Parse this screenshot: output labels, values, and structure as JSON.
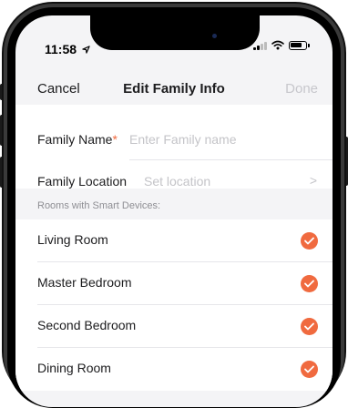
{
  "status_bar": {
    "time": "11:58",
    "location_icon": "location-arrow-icon"
  },
  "navbar": {
    "cancel_label": "Cancel",
    "title": "Edit Family Info",
    "done_label": "Done"
  },
  "form": {
    "family_name": {
      "label": "Family Name",
      "required_marker": "*",
      "placeholder": "Enter Family name",
      "value": ""
    },
    "family_location": {
      "label": "Family Location",
      "placeholder": "Set location",
      "chevron_glyph": ">"
    }
  },
  "rooms_section": {
    "title": "Rooms with Smart Devices:",
    "rooms": [
      {
        "label": "Living Room",
        "checked": true
      },
      {
        "label": "Master Bedroom",
        "checked": true
      },
      {
        "label": "Second Bedroom",
        "checked": true
      },
      {
        "label": "Dining Room",
        "checked": true
      }
    ]
  },
  "colors": {
    "accent": "#f06a3f",
    "background": "#f4f4f6",
    "card": "#ffffff",
    "placeholder": "#c4c4c8",
    "secondary_text": "#8e8e93"
  }
}
